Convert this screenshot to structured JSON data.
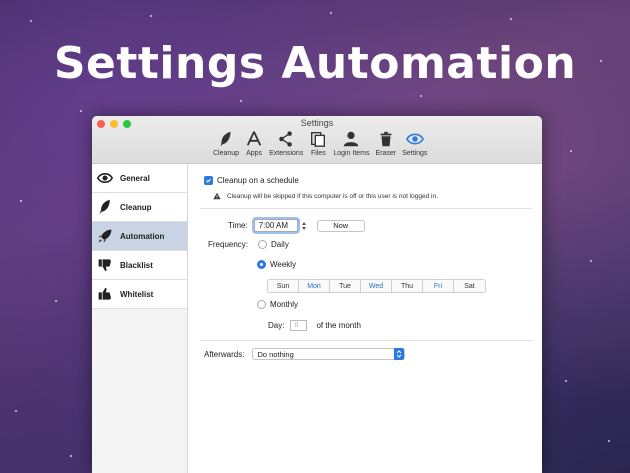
{
  "hero": {
    "title": "Settings Automation"
  },
  "window": {
    "title": "Settings",
    "toolbar": [
      {
        "label": "Cleanup",
        "icon": "feather-icon"
      },
      {
        "label": "Apps",
        "icon": "apps-icon"
      },
      {
        "label": "Extensions",
        "icon": "share-icon"
      },
      {
        "label": "Files",
        "icon": "files-icon"
      },
      {
        "label": "Login Items",
        "icon": "user-icon"
      },
      {
        "label": "Eraser",
        "icon": "trash-icon"
      },
      {
        "label": "Settings",
        "icon": "eye-icon"
      }
    ]
  },
  "sidebar": {
    "items": [
      {
        "label": "General",
        "icon": "eye-icon",
        "active": false
      },
      {
        "label": "Cleanup",
        "icon": "feather-icon",
        "active": false
      },
      {
        "label": "Automation",
        "icon": "rocket-icon",
        "active": true
      },
      {
        "label": "Blacklist",
        "icon": "thumbs-down-icon",
        "active": false
      },
      {
        "label": "Whitelist",
        "icon": "thumbs-up-icon",
        "active": false
      }
    ]
  },
  "automation": {
    "cleanup_schedule_label": "Cleanup on a schedule",
    "cleanup_schedule_checked": true,
    "warning_text": "Cleanup will be skipped if this computer is off or this user is not logged in.",
    "time_label": "Time:",
    "time_value": "7:00 AM",
    "now_button": "Now",
    "frequency_label": "Frequency:",
    "daily_label": "Daily",
    "weekly_label": "Weekly",
    "monthly_label": "Monthly",
    "selected_frequency": "Weekly",
    "days": [
      {
        "label": "Sun",
        "selected": false
      },
      {
        "label": "Mon",
        "selected": true
      },
      {
        "label": "Tue",
        "selected": false
      },
      {
        "label": "Wed",
        "selected": true
      },
      {
        "label": "Thu",
        "selected": false
      },
      {
        "label": "Fri",
        "selected": true
      },
      {
        "label": "Sat",
        "selected": false
      }
    ],
    "day_label": "Day:",
    "day_placeholder": "0",
    "of_the_month": "of the month",
    "afterwards_label": "Afterwards:",
    "afterwards_value": "Do nothing"
  },
  "colors": {
    "accent": "#2a7ae2",
    "sidebar_active": "#c8d4e4"
  }
}
